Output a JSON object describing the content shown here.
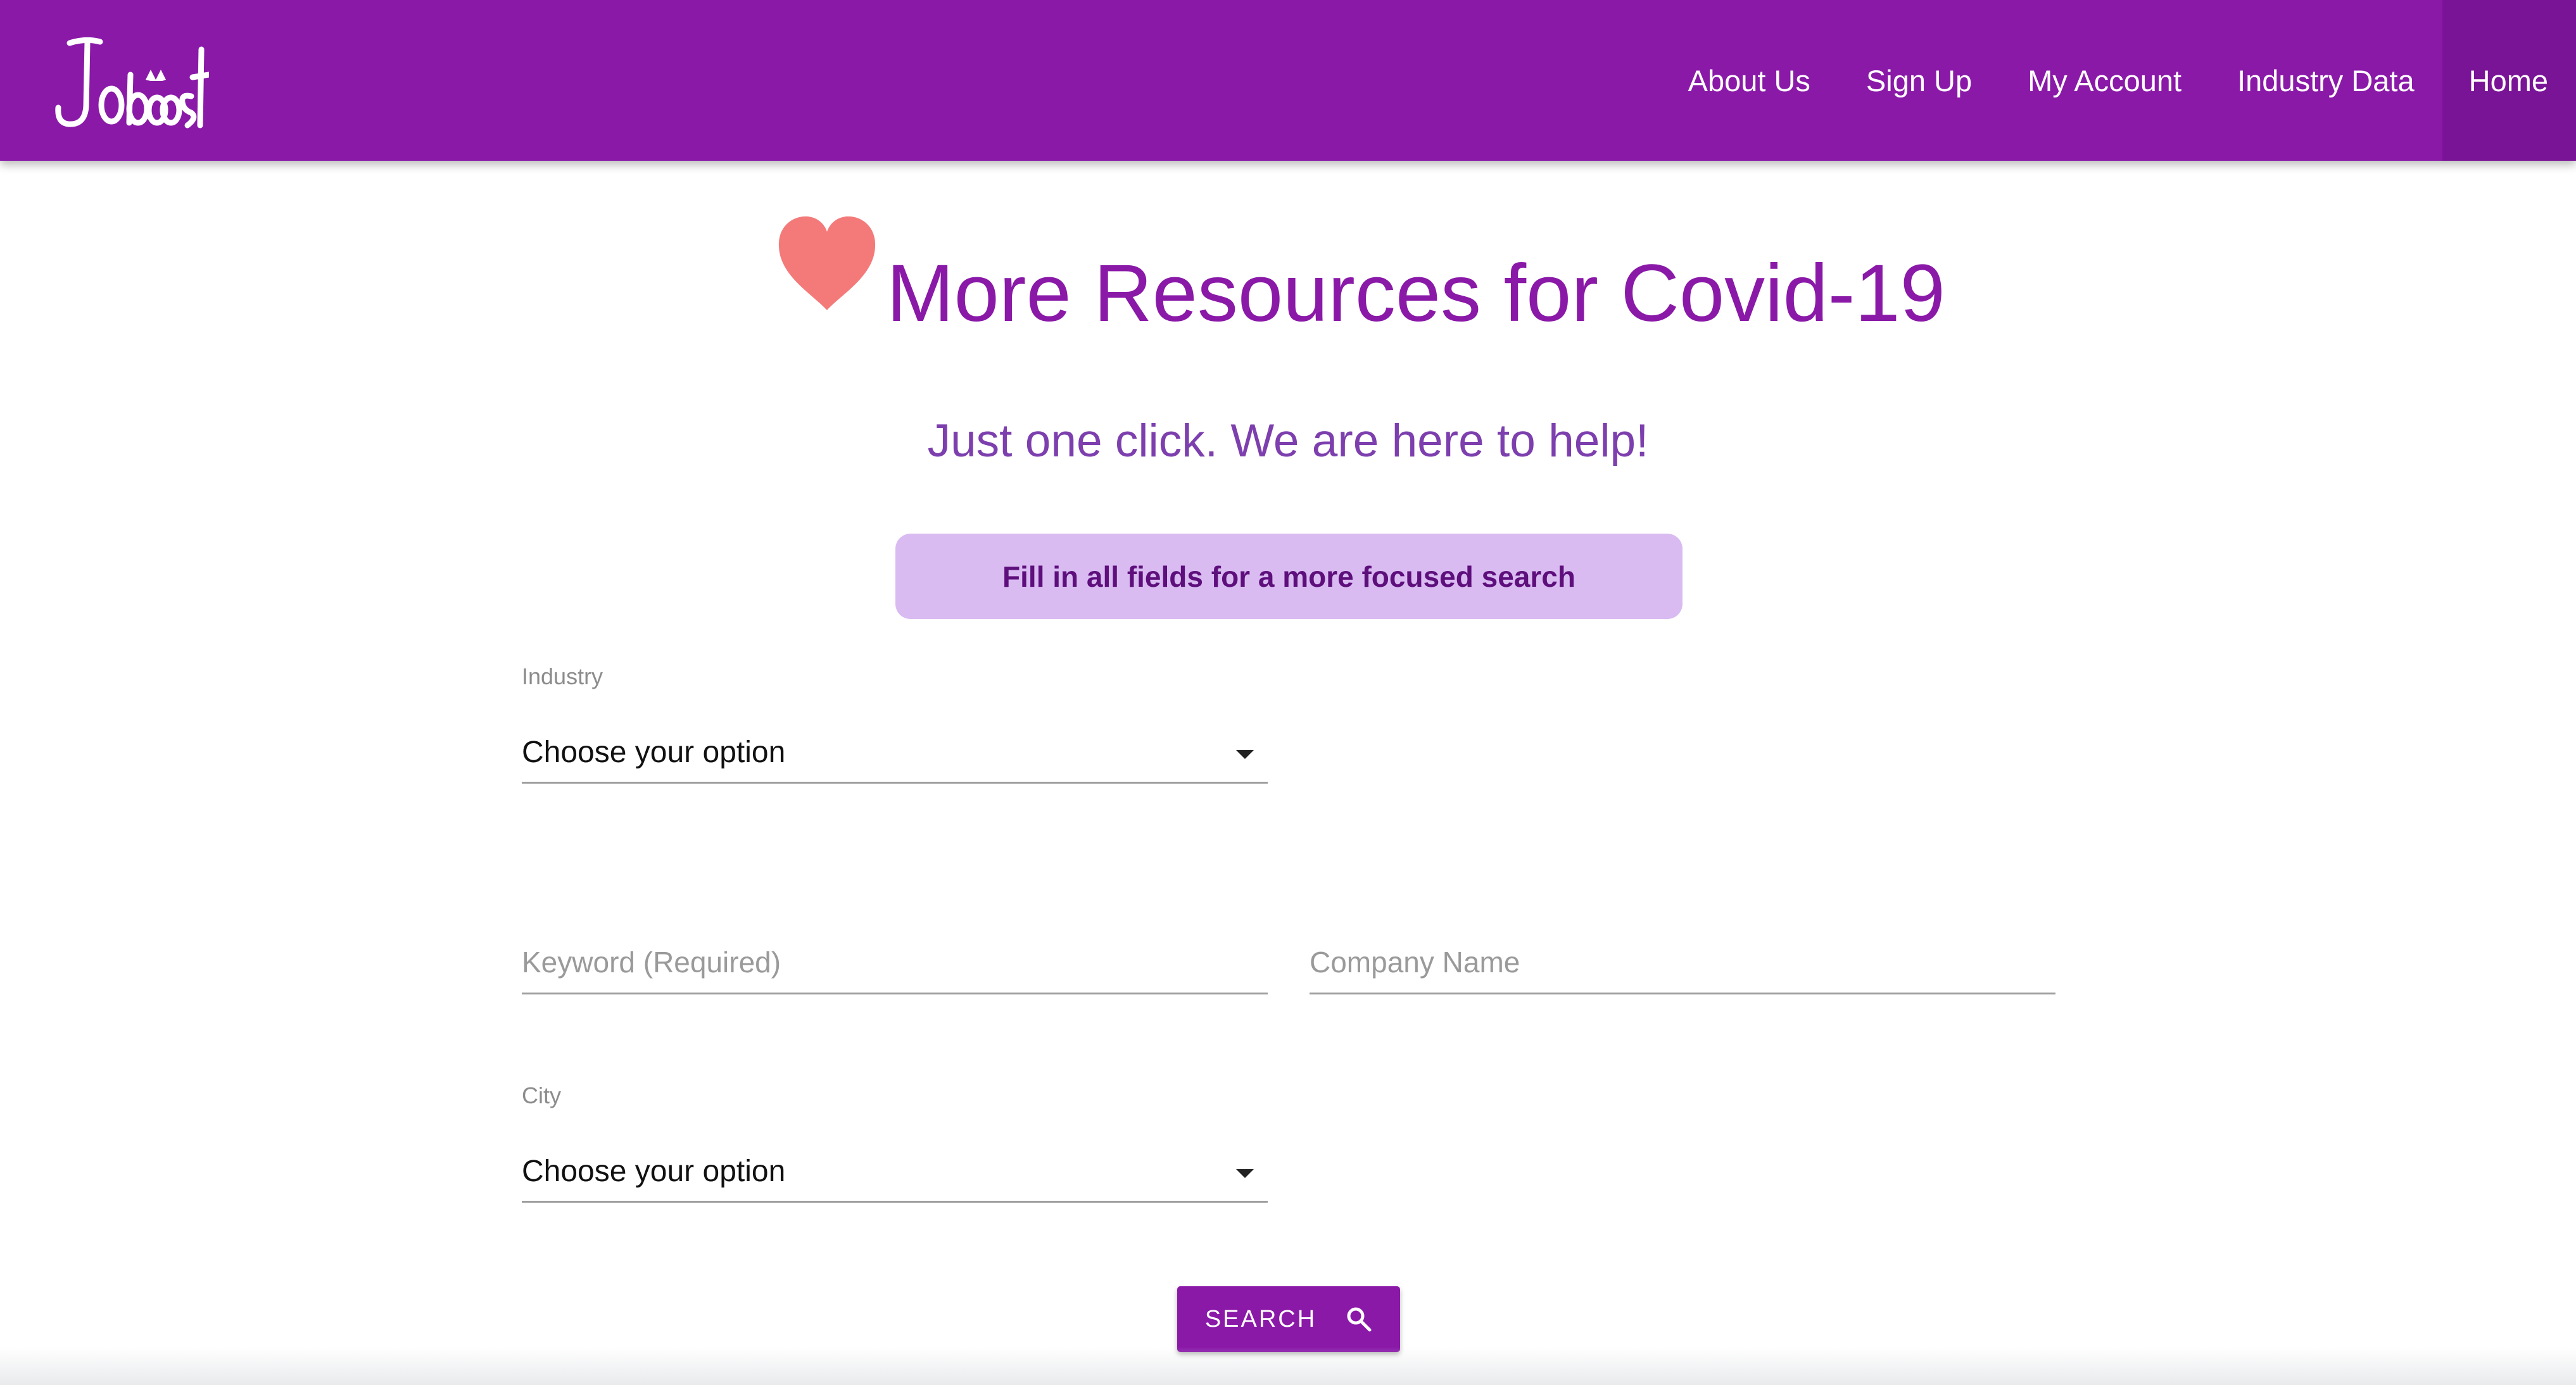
{
  "brand": {
    "logo_text": "Joboost",
    "accent_color": "#8a19a8"
  },
  "nav": {
    "items": [
      {
        "label": "About Us"
      },
      {
        "label": "Sign Up"
      },
      {
        "label": "My Account"
      },
      {
        "label": "Industry Data"
      },
      {
        "label": "Home",
        "active": true
      }
    ]
  },
  "hero": {
    "title": "More Resources for Covid-19",
    "icon": "heart-icon",
    "subtitle": "Just one click. We are here to help!",
    "banner": "Fill in all fields for a more focused search"
  },
  "form": {
    "industry": {
      "label": "Industry",
      "value": "Choose your option"
    },
    "keyword": {
      "placeholder": "Keyword (Required)",
      "value": ""
    },
    "company": {
      "placeholder": "Company Name",
      "value": ""
    },
    "city": {
      "label": "City",
      "value": "Choose your option"
    },
    "search_button": {
      "label": "SEARCH",
      "icon": "search-icon"
    }
  }
}
